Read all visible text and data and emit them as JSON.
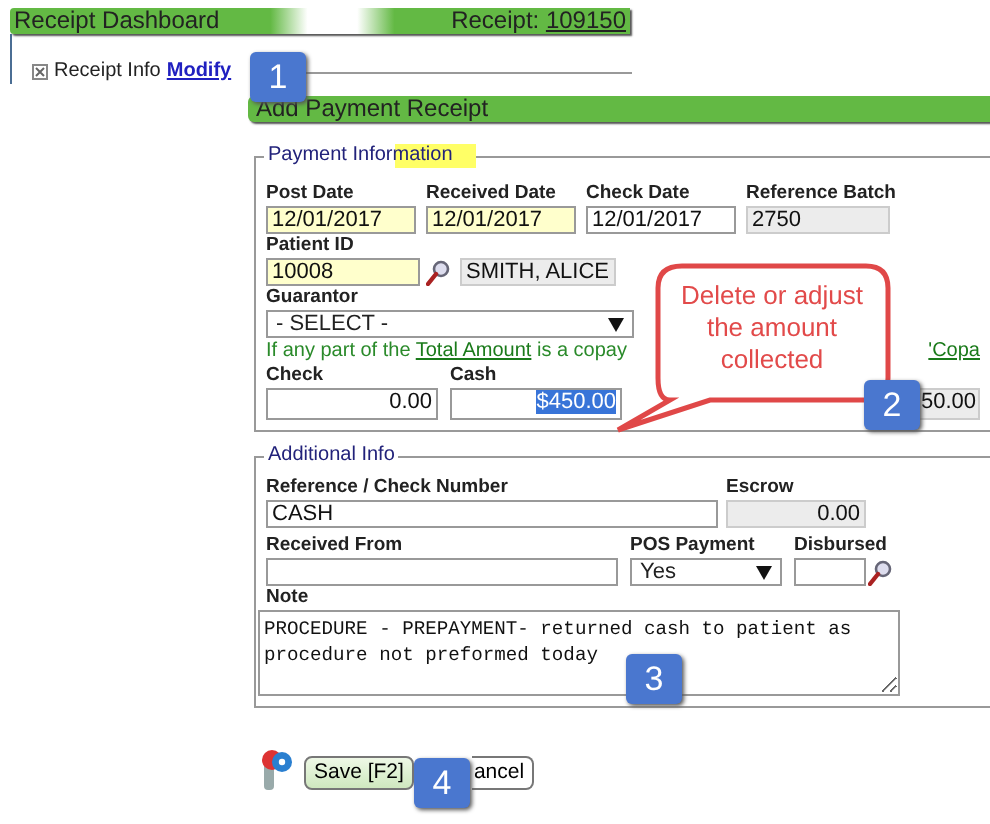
{
  "header": {
    "title": "Receipt Dashboard",
    "receipt_label": "Receipt:",
    "receipt_number": "109150"
  },
  "section": {
    "title": "Receipt Info",
    "link": "Modify",
    "collapsed": false
  },
  "form_title": "Add Payment Receipt",
  "payment_info": {
    "legend": "Payment Information",
    "date_row": [
      {
        "label": "Post Date",
        "value": "12/01/2017",
        "kind": "input",
        "highlighted": true
      },
      {
        "label": "Received Date",
        "value": "12/01/2017",
        "kind": "input",
        "highlighted": true
      },
      {
        "label": "Check Date",
        "value": "12/01/2017",
        "kind": "input",
        "highlighted": false
      },
      {
        "label": "Reference Batch",
        "value": "2750",
        "kind": "readonly",
        "highlighted": false
      }
    ],
    "patient": {
      "label": "Patient ID",
      "value": "10008",
      "highlighted": true,
      "name": "SMITH, ALICE"
    },
    "guarantor": {
      "label": "Guarantor",
      "value": "- SELECT -"
    },
    "copay_note": {
      "before": "If any part of the ",
      "link": "Total Amount",
      "after": " is a copay",
      "tail": "'Copa"
    },
    "amounts": [
      {
        "label": "Check",
        "value": "0.00",
        "text_selected": false
      },
      {
        "label": "Cash",
        "value": "$450.00",
        "text_selected": true
      }
    ],
    "amount_tail": "50.00"
  },
  "additional_info": {
    "legend": "Additional Info",
    "reference": {
      "label": "Reference / Check Number",
      "value": "CASH"
    },
    "escrow": {
      "label": "Escrow",
      "value": "0.00"
    },
    "received_from": {
      "label": "Received From"
    },
    "pos_payment": {
      "label": "POS Payment",
      "value": "Yes"
    },
    "disbursed": {
      "label": "Disbursed"
    },
    "note": {
      "label": "Note",
      "value": "PROCEDURE - PREPAYMENT- returned cash to patient as procedure not preformed today"
    }
  },
  "buttons": [
    {
      "label": "Save [F2]",
      "kind": "save"
    },
    {
      "label": "ancel",
      "kind": "cancel"
    }
  ],
  "callout": {
    "text": "Delete or adjust the amount collected"
  },
  "step_badges": [
    "1",
    "2",
    "3",
    "4"
  ]
}
